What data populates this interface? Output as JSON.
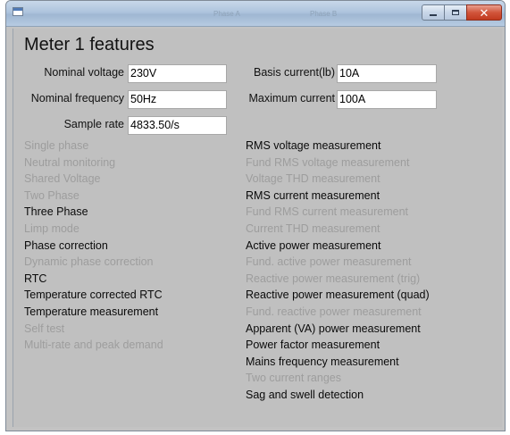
{
  "colors": {
    "window_background": "#c3c3c3",
    "enabled_text": "#0a0a0a",
    "disabled_text": "#9d9d9d",
    "close_button": "#c9442a"
  },
  "titlebar": {
    "ghost_tab_a": "Phase A",
    "ghost_tab_b": "Phase B",
    "icons": {
      "minimize": "minimize-icon",
      "maximize": "maximize-icon",
      "close": "close-icon"
    }
  },
  "page": {
    "title": "Meter 1 features"
  },
  "fields": {
    "nominal_voltage": {
      "label": "Nominal voltage",
      "value": "230V"
    },
    "nominal_frequency": {
      "label": "Nominal frequency",
      "value": "50Hz"
    },
    "sample_rate": {
      "label": "Sample rate",
      "value": "4833.50/s"
    },
    "basis_current": {
      "label": "Basis current(lb)",
      "value": "10A"
    },
    "maximum_current": {
      "label": "Maximum current",
      "value": "100A"
    }
  },
  "features_left": [
    {
      "label": "Single phase",
      "enabled": false
    },
    {
      "label": "Neutral monitoring",
      "enabled": false
    },
    {
      "label": "Shared Voltage",
      "enabled": false
    },
    {
      "label": "Two Phase",
      "enabled": false
    },
    {
      "label": "Three Phase",
      "enabled": true
    },
    {
      "label": "Limp mode",
      "enabled": false
    },
    {
      "label": "Phase correction",
      "enabled": true
    },
    {
      "label": "Dynamic phase correction",
      "enabled": false
    },
    {
      "label": "RTC",
      "enabled": true
    },
    {
      "label": "Temperature corrected RTC",
      "enabled": true
    },
    {
      "label": "Temperature measurement",
      "enabled": true
    },
    {
      "label": "Self test",
      "enabled": false
    },
    {
      "label": "Multi-rate and peak demand",
      "enabled": false
    }
  ],
  "features_right": [
    {
      "label": "RMS voltage measurement",
      "enabled": true
    },
    {
      "label": "Fund RMS voltage measurement",
      "enabled": false
    },
    {
      "label": "Voltage THD measurement",
      "enabled": false
    },
    {
      "label": "RMS current measurement",
      "enabled": true
    },
    {
      "label": "Fund RMS current measurement",
      "enabled": false
    },
    {
      "label": "Current THD measurement",
      "enabled": false
    },
    {
      "label": "Active power measurement",
      "enabled": true
    },
    {
      "label": "Fund. active power measurement",
      "enabled": false
    },
    {
      "label": "Reactive power measurement (trig)",
      "enabled": false
    },
    {
      "label": "Reactive power measurement (quad)",
      "enabled": true
    },
    {
      "label": "Fund. reactive power measurement",
      "enabled": false
    },
    {
      "label": "Apparent (VA) power measurement",
      "enabled": true
    },
    {
      "label": "Power factor measurement",
      "enabled": true
    },
    {
      "label": "Mains frequency measurement",
      "enabled": true
    },
    {
      "label": "Two current ranges",
      "enabled": false
    },
    {
      "label": "Sag and swell detection",
      "enabled": true
    }
  ]
}
